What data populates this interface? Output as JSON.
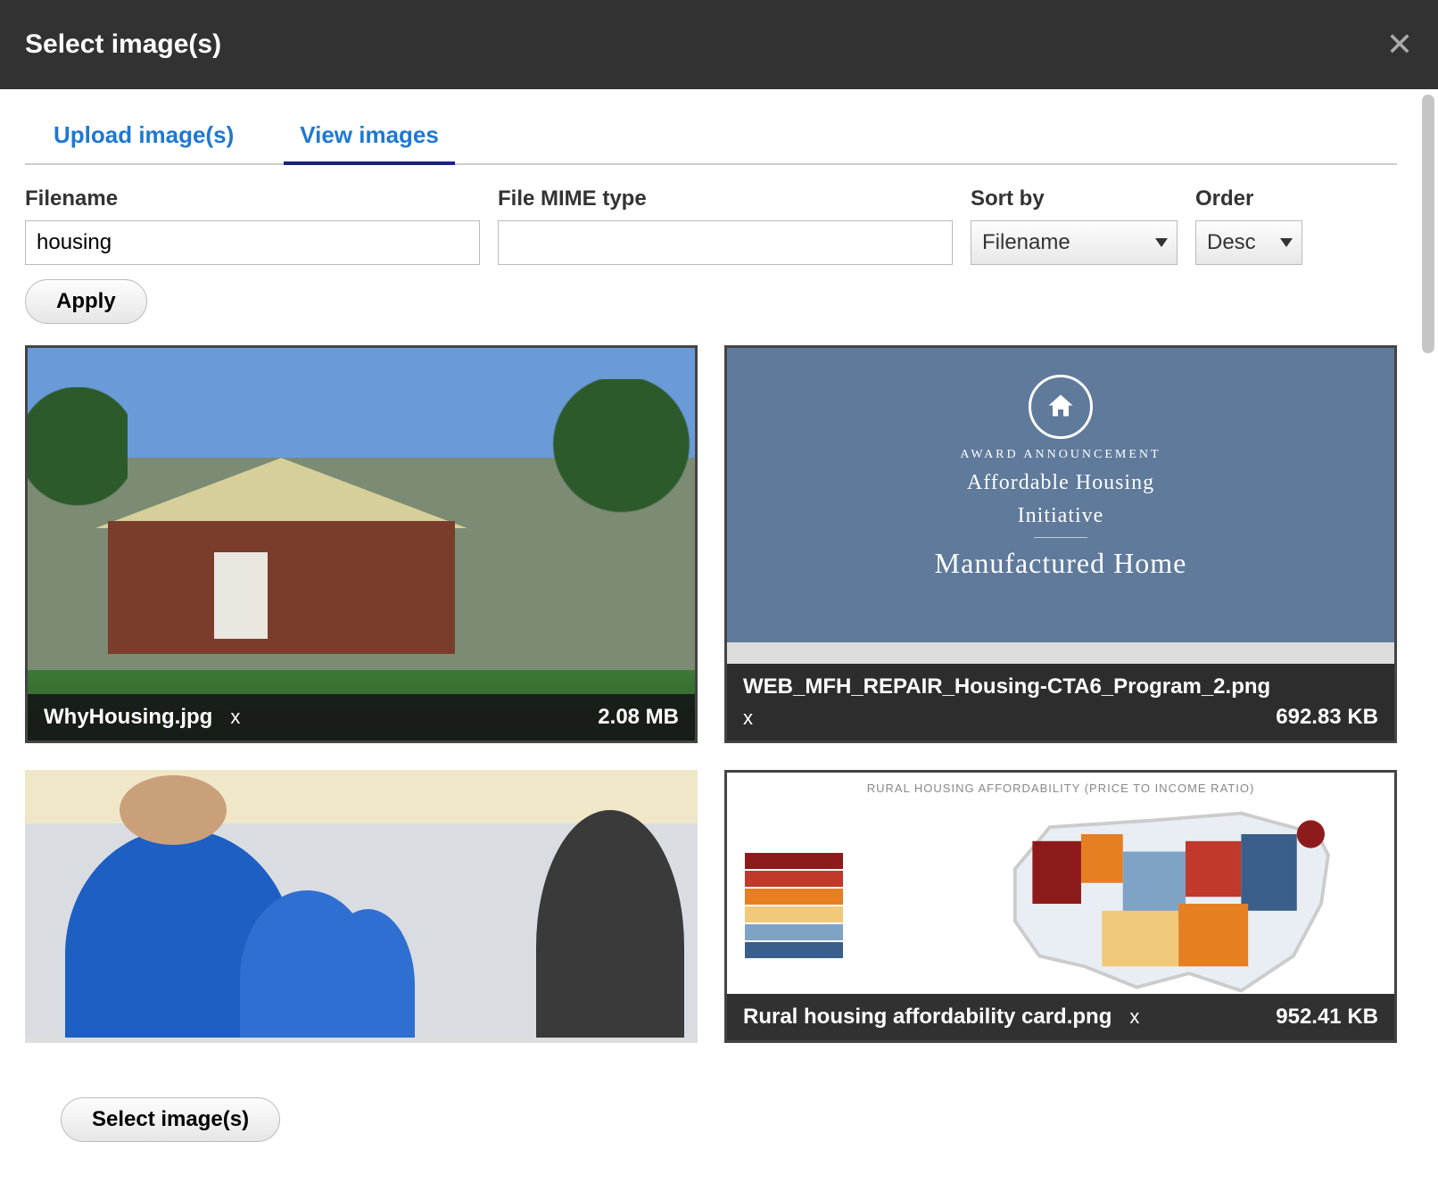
{
  "modal": {
    "title": "Select image(s)"
  },
  "tabs": {
    "upload": "Upload image(s)",
    "view": "View images"
  },
  "filters": {
    "filename_label": "Filename",
    "filename_value": "housing",
    "mime_label": "File MIME type",
    "mime_value": "",
    "sortby_label": "Sort by",
    "sortby_value": "Filename",
    "order_label": "Order",
    "order_value": "Desc",
    "apply_label": "Apply"
  },
  "images": [
    {
      "filename": "WhyHousing.jpg",
      "size": "2.08 MB",
      "remove": "x"
    },
    {
      "filename": "WEB_MFH_REPAIR_Housing-CTA6_Program_2.png",
      "size": "692.83 KB",
      "remove": "x",
      "preview": {
        "eyebrow": "AWARD ANNOUNCEMENT",
        "line1": "Affordable Housing",
        "line2": "Initiative",
        "line3": "Manufactured Home"
      }
    },
    {
      "filename": "",
      "size": "",
      "remove": ""
    },
    {
      "filename": "Rural housing affordability card.png",
      "size": "952.41 KB",
      "remove": "x",
      "preview": {
        "title": "RURAL HOUSING AFFORDABILITY (PRICE TO INCOME RATIO)"
      }
    }
  ],
  "footer": {
    "select_label": "Select image(s)"
  }
}
